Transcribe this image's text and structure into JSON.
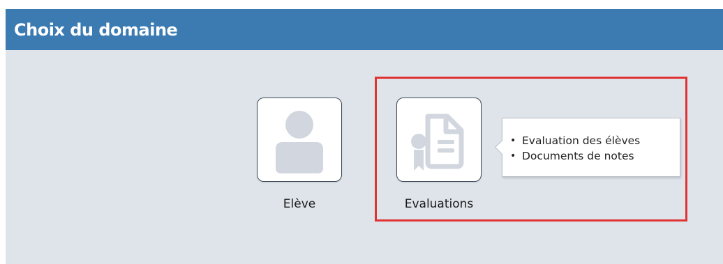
{
  "header": {
    "title": "Choix du domaine"
  },
  "domains": [
    {
      "label": "Elève",
      "icon": "user-icon"
    },
    {
      "label": "Evaluations",
      "icon": "certificate-document-icon"
    }
  ],
  "tooltip": {
    "items": [
      "Evaluation des élèves",
      "Documents de notes"
    ]
  },
  "colors": {
    "header_bg": "#3b7bb2",
    "panel_bg": "#dfe4eb",
    "highlight": "#e03434",
    "icon_gray": "#d2d7df"
  }
}
